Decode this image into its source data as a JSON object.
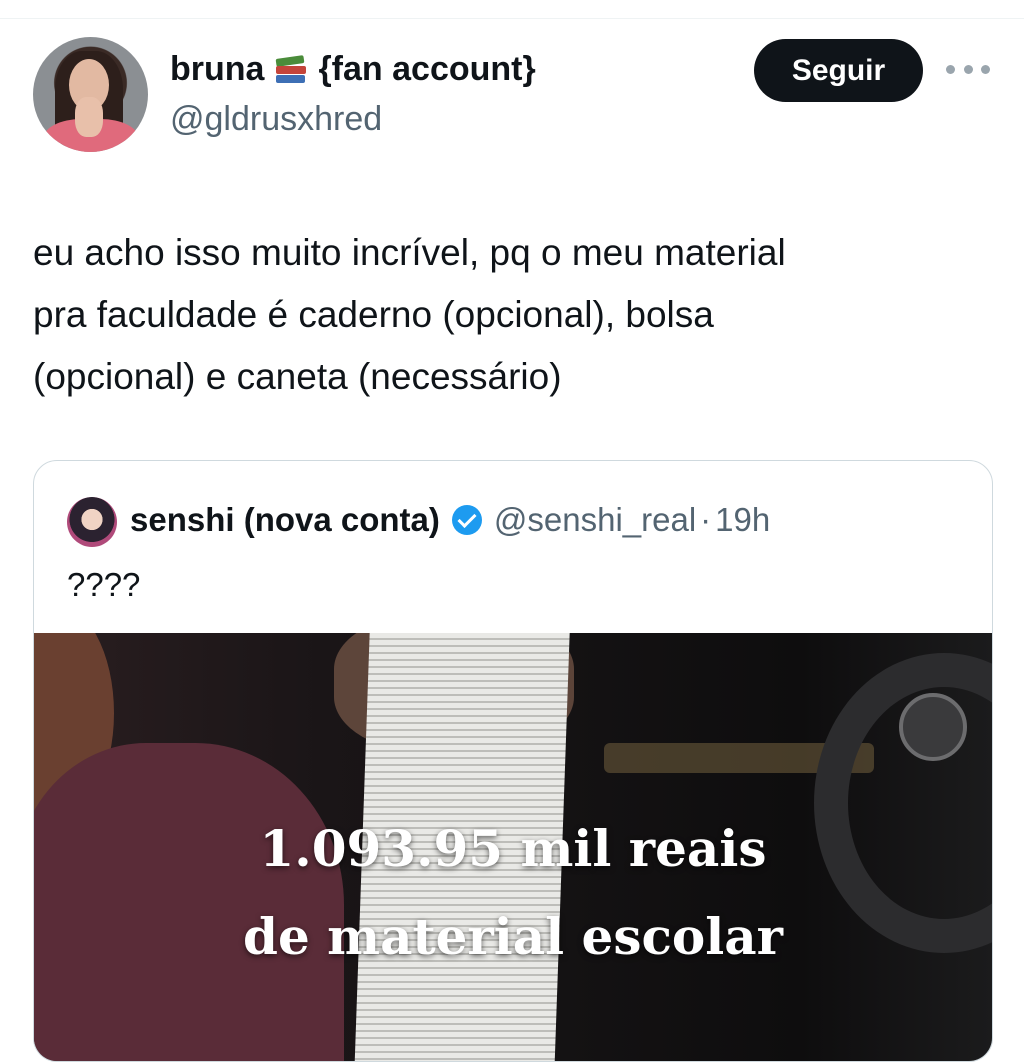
{
  "tweet": {
    "author_name": "bruna",
    "author_emoji_icon": "books-icon",
    "author_suffix": "{fan account}",
    "handle": "@gldrusxhred",
    "follow_label": "Seguir",
    "text_lines": [
      "eu acho isso muito incrível, pq o meu material",
      "pra faculdade é caderno (opcional), bolsa",
      "(opcional) e caneta (necessário)"
    ]
  },
  "quote": {
    "name": "senshi (nova conta)",
    "handle": "@senshi_real",
    "separator": "·",
    "time": "19h",
    "text": "????",
    "media_caption_lines": [
      "1.093.95 mil reais",
      "de material escolar"
    ]
  },
  "colors": {
    "text_primary": "#0f1419",
    "text_secondary": "#536471",
    "follow_button_bg": "#0f1419",
    "verified_badge": "#1d9bf0",
    "border": "#cfd9de"
  }
}
